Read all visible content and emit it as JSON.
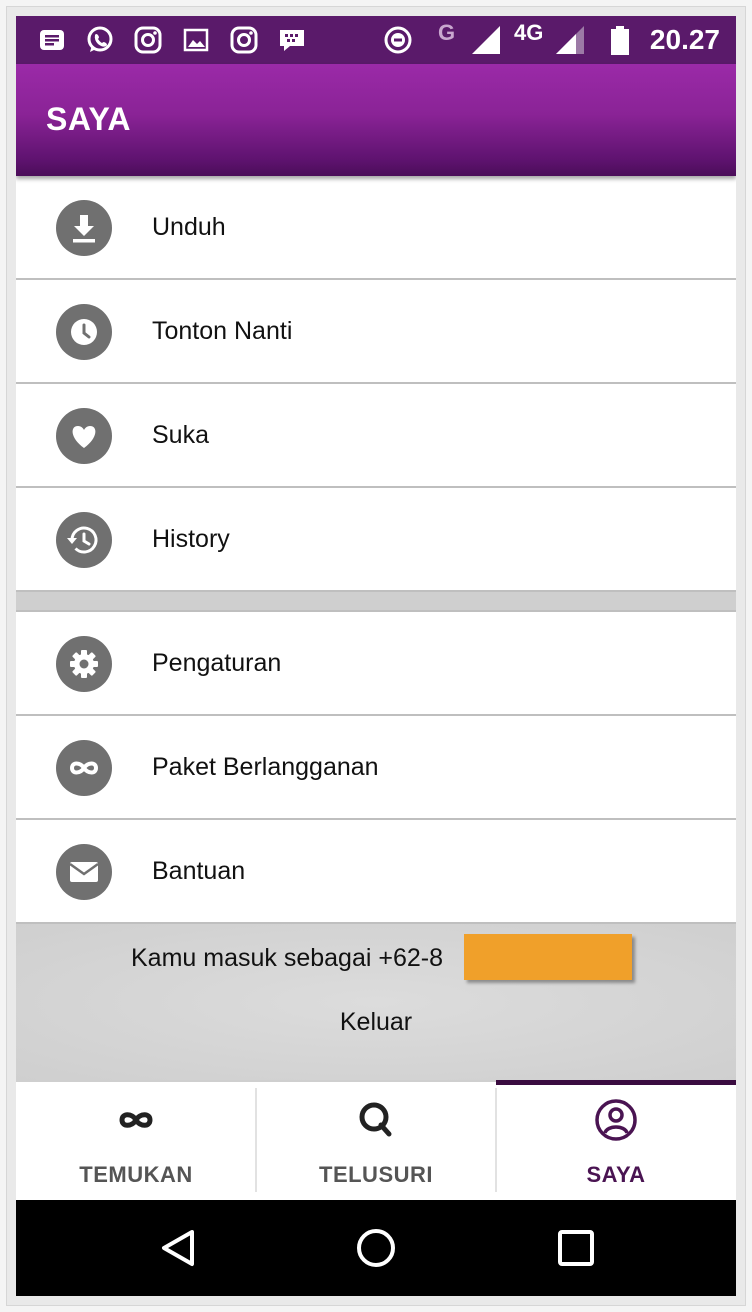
{
  "status_bar": {
    "network_g": "G",
    "network_4g": "4G",
    "time": "20.27",
    "icons": [
      "notes-icon",
      "whatsapp-icon",
      "instagram-icon",
      "gallery-icon",
      "instagram-icon",
      "bbm-icon",
      "data-saver-icon",
      "signal-icon",
      "signal-icon",
      "battery-icon"
    ]
  },
  "app_bar": {
    "title": "SAYA"
  },
  "menu": {
    "items": [
      {
        "label": "Unduh",
        "icon": "download-icon"
      },
      {
        "label": "Tonton Nanti",
        "icon": "clock-icon"
      },
      {
        "label": "Suka",
        "icon": "heart-icon"
      },
      {
        "label": "History",
        "icon": "history-icon"
      },
      {
        "label": "Pengaturan",
        "icon": "gear-icon"
      },
      {
        "label": "Paket Berlangganan",
        "icon": "infinity-icon"
      },
      {
        "label": "Bantuan",
        "icon": "mail-icon"
      }
    ]
  },
  "account": {
    "logged_in_text": "Kamu masuk sebagai +62-8",
    "logout_label": "Keluar"
  },
  "bottom_nav": {
    "tabs": [
      {
        "label": "TEMUKAN",
        "icon": "infinity-icon",
        "active": false
      },
      {
        "label": "TELUSURI",
        "icon": "search-icon",
        "active": false
      },
      {
        "label": "SAYA",
        "icon": "profile-icon",
        "active": true
      }
    ]
  },
  "colors": {
    "app_bar": "#8a2396",
    "status_bar": "#5a1a6a",
    "icon_circle": "#707070",
    "active_tab": "#4a1452",
    "redaction": "#f0a02a"
  }
}
